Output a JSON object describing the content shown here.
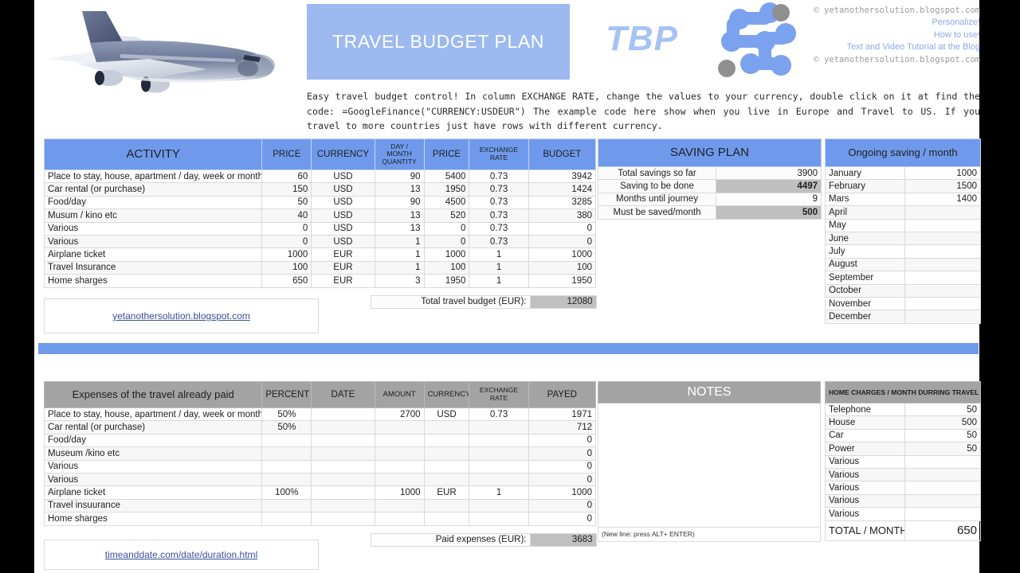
{
  "header": {
    "title": "TRAVEL BUDGET PLAN",
    "logo_text": "TBP",
    "copyright_top": "© yetanothersolution.blogspot.com",
    "copyright_bottom": "© yetanothersolution.blogspot.com",
    "links": [
      "Personalize!",
      "How to use!",
      "Text and Video Tutorial at the Blog"
    ],
    "description": "Easy travel budget control! In column EXCHANGE RATE, change the values to your currency, double click on it at find the code: =GoogleFinance(\"CURRENCY:USDEUR\") The example code here show when you live in Europe and Travel to US. If you travel to more countries just have rows with different currency."
  },
  "activity_table": {
    "columns": [
      "ACTIVITY",
      "PRICE",
      "CURRENCY",
      "DAY / MONTH QUANTITY",
      "PRICE",
      "EXCHANGE RATE",
      "BUDGET"
    ],
    "col_day_line1": "DAY /",
    "col_day_line2": "MONTH",
    "col_day_line3": "QUANTITY",
    "col_exch_line1": "EXCHANGE",
    "col_exch_line2": "RATE",
    "rows": [
      {
        "activity": "Place to stay, house, apartment / day, week or month",
        "price": "60",
        "currency": "USD",
        "qty": "90",
        "price2": "5400",
        "rate": "0.73",
        "budget": "3942"
      },
      {
        "activity": "Car rental (or purchase)",
        "price": "150",
        "currency": "USD",
        "qty": "13",
        "price2": "1950",
        "rate": "0.73",
        "budget": "1424"
      },
      {
        "activity": "Food/day",
        "price": "50",
        "currency": "USD",
        "qty": "90",
        "price2": "4500",
        "rate": "0.73",
        "budget": "3285"
      },
      {
        "activity": "Musum / kino etc",
        "price": "40",
        "currency": "USD",
        "qty": "13",
        "price2": "520",
        "rate": "0.73",
        "budget": "380"
      },
      {
        "activity": "Various",
        "price": "0",
        "currency": "USD",
        "qty": "13",
        "price2": "0",
        "rate": "0.73",
        "budget": "0"
      },
      {
        "activity": "Various",
        "price": "0",
        "currency": "USD",
        "qty": "1",
        "price2": "0",
        "rate": "0.73",
        "budget": "0"
      },
      {
        "activity": "Airplane ticket",
        "price": "1000",
        "currency": "EUR",
        "qty": "1",
        "price2": "1000",
        "rate": "1",
        "budget": "1000"
      },
      {
        "activity": "Travel Insurance",
        "price": "100",
        "currency": "EUR",
        "qty": "1",
        "price2": "100",
        "rate": "1",
        "budget": "100"
      },
      {
        "activity": "Home sharges",
        "price": "650",
        "currency": "EUR",
        "qty": "3",
        "price2": "1950",
        "rate": "1",
        "budget": "1950"
      }
    ],
    "total_label": "Total travel budget (EUR):",
    "total_value": "12080"
  },
  "saving_plan": {
    "title": "SAVING PLAN",
    "rows": [
      {
        "label": "Total savings so far",
        "value": "3900",
        "highlight": false
      },
      {
        "label": "Saving to be done",
        "value": "4497",
        "highlight": true
      },
      {
        "label": "Months until journey",
        "value": "9",
        "highlight": false
      },
      {
        "label": "Must be saved/month",
        "value": "500",
        "highlight": true
      }
    ]
  },
  "ongoing_saving": {
    "title": "Ongoing saving / month",
    "rows": [
      {
        "month": "January",
        "value": "1000"
      },
      {
        "month": "February",
        "value": "1500"
      },
      {
        "month": "Mars",
        "value": "1400"
      },
      {
        "month": "April",
        "value": ""
      },
      {
        "month": "May",
        "value": ""
      },
      {
        "month": "June",
        "value": ""
      },
      {
        "month": "July",
        "value": ""
      },
      {
        "month": "August",
        "value": ""
      },
      {
        "month": "September",
        "value": ""
      },
      {
        "month": "October",
        "value": ""
      },
      {
        "month": "November",
        "value": ""
      },
      {
        "month": "December",
        "value": ""
      }
    ]
  },
  "link_top": "yetanothersolution.blogspot.com",
  "link_bottom": "timeanddate.com/date/duration.html",
  "expenses_table": {
    "columns": [
      "Expenses of the travel already paid",
      "PERCENT",
      "DATE",
      "AMOUNT",
      "CURRENCY",
      "EXCHANGE RATE",
      "PAYED"
    ],
    "col_exch_line1": "EXCHANGE",
    "col_exch_line2": "RATE",
    "rows": [
      {
        "activity": "Place to stay, house, apartment / day, week or month",
        "percent": "50%",
        "date": "",
        "amount": "2700",
        "currency": "USD",
        "rate": "0.73",
        "payed": "1971"
      },
      {
        "activity": "Car rental (or purchase)",
        "percent": "50%",
        "date": "",
        "amount": "",
        "currency": "",
        "rate": "",
        "payed": "712"
      },
      {
        "activity": "Food/day",
        "percent": "",
        "date": "",
        "amount": "",
        "currency": "",
        "rate": "",
        "payed": "0"
      },
      {
        "activity": "Museum /kino etc",
        "percent": "",
        "date": "",
        "amount": "",
        "currency": "",
        "rate": "",
        "payed": "0"
      },
      {
        "activity": "Various",
        "percent": "",
        "date": "",
        "amount": "",
        "currency": "",
        "rate": "",
        "payed": "0"
      },
      {
        "activity": "Various",
        "percent": "",
        "date": "",
        "amount": "",
        "currency": "",
        "rate": "",
        "payed": "0"
      },
      {
        "activity": "Airplane ticket",
        "percent": "100%",
        "date": "",
        "amount": "1000",
        "currency": "EUR",
        "rate": "1",
        "payed": "1000"
      },
      {
        "activity": "Travel insuurance",
        "percent": "",
        "date": "",
        "amount": "",
        "currency": "",
        "rate": "",
        "payed": "0"
      },
      {
        "activity": "Home sharges",
        "percent": "",
        "date": "",
        "amount": "",
        "currency": "",
        "rate": "",
        "payed": "0"
      }
    ],
    "total_label": "Paid expenses (EUR):",
    "total_value": "3683"
  },
  "notes": {
    "title": "NOTES",
    "hint": "(New line: press  ALT+ ENTER)",
    "content": ""
  },
  "home_charges": {
    "title": "HOME CHARGES / MONTH DURRING TRAVEL",
    "rows": [
      {
        "item": "Telephone",
        "value": "50"
      },
      {
        "item": "House",
        "value": "500"
      },
      {
        "item": "Car",
        "value": "50"
      },
      {
        "item": "Power",
        "value": "50"
      },
      {
        "item": "Various",
        "value": ""
      },
      {
        "item": "Various",
        "value": ""
      },
      {
        "item": "Various",
        "value": ""
      },
      {
        "item": "Various",
        "value": ""
      },
      {
        "item": "Various",
        "value": ""
      }
    ],
    "total_label": "TOTAL / MONTH:",
    "total_value": "650"
  },
  "colors": {
    "accent_blue": "#6f9aec",
    "title_blue": "#9cb9f0",
    "logo_blue": "#a6c2f5",
    "gray_header": "#a3a3a3",
    "highlight_gray": "#c0c0c0"
  }
}
